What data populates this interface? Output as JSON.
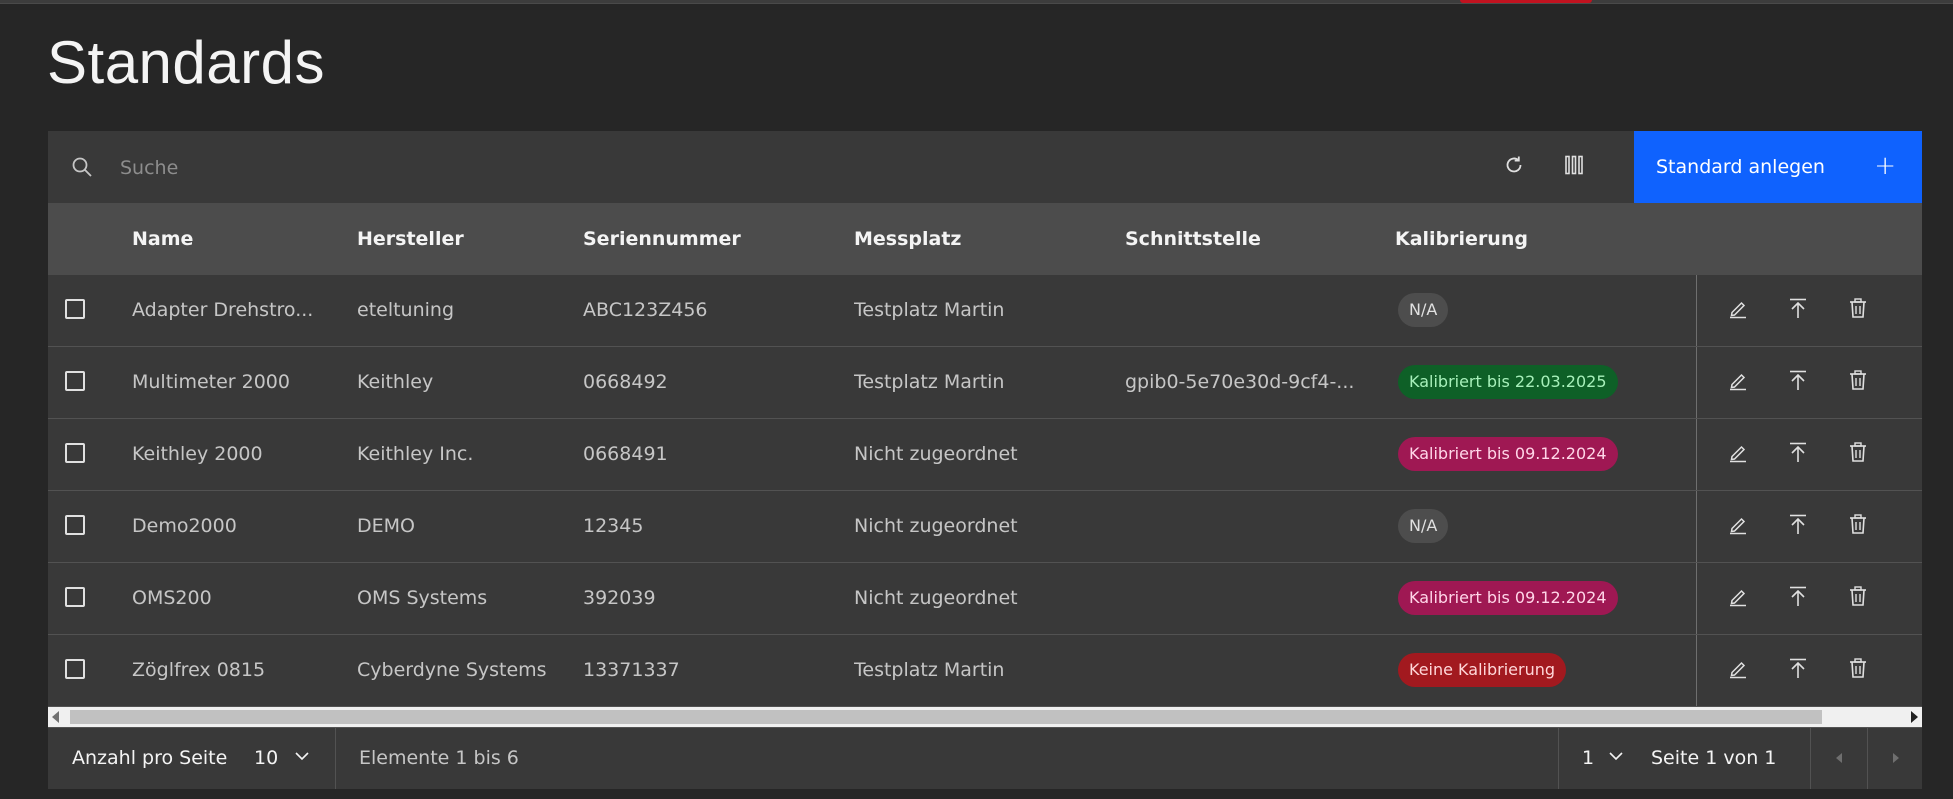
{
  "page": {
    "title": "Standards"
  },
  "toolbar": {
    "search_placeholder": "Suche",
    "primary_button_label": "Standard anlegen",
    "primary_button_color": "#0f62fe"
  },
  "table": {
    "headers": [
      "Name",
      "Hersteller",
      "Seriennummer",
      "Messplatz",
      "Schnittstelle",
      "Kalibrierung"
    ],
    "rows": [
      {
        "name": "Adapter Drehstro...",
        "hersteller": "eteltuning",
        "seriennummer": "ABC123Z456",
        "messplatz": "Testplatz Martin",
        "schnittstelle": "",
        "kalibrierung": "N/A",
        "status": "na"
      },
      {
        "name": "Multimeter 2000",
        "hersteller": "Keithley",
        "seriennummer": "0668492",
        "messplatz": "Testplatz Martin",
        "schnittstelle": "gpib0-5e70e30d-9cf4-...",
        "kalibrierung": "Kalibriert bis 22.03.2025",
        "status": "valid"
      },
      {
        "name": "Keithley 2000",
        "hersteller": "Keithley Inc.",
        "seriennummer": "0668491",
        "messplatz": "Nicht zugeordnet",
        "schnittstelle": "",
        "kalibrierung": "Kalibriert bis 09.12.2024",
        "status": "expired"
      },
      {
        "name": "Demo2000",
        "hersteller": "DEMO",
        "seriennummer": "12345",
        "messplatz": "Nicht zugeordnet",
        "schnittstelle": "",
        "kalibrierung": "N/A",
        "status": "na"
      },
      {
        "name": "OMS200",
        "hersteller": "OMS Systems",
        "seriennummer": "392039",
        "messplatz": "Nicht zugeordnet",
        "schnittstelle": "",
        "kalibrierung": "Kalibriert bis 09.12.2024",
        "status": "expired"
      },
      {
        "name": "Zöglfrex 0815",
        "hersteller": "Cyberdyne Systems",
        "seriennummer": "13371337",
        "messplatz": "Testplatz Martin",
        "schnittstelle": "",
        "kalibrierung": "Keine Kalibrierung",
        "status": "none"
      }
    ]
  },
  "status_colors": {
    "na": {
      "bg": "#4d4d4d",
      "fg": "#e0e0e0"
    },
    "valid": {
      "bg": "#0e6027",
      "fg": "#a7f0ba"
    },
    "expired": {
      "bg": "#9f1853",
      "fg": "#ffd6e8"
    },
    "none": {
      "bg": "#a2191f",
      "fg": "#ffd7d9"
    }
  },
  "pagination": {
    "items_per_page_label": "Anzahl pro Seite",
    "items_per_page_value": "10",
    "range_text": "Elemente 1 bis 6",
    "page_value": "1",
    "page_of_text": "Seite 1 von 1"
  }
}
